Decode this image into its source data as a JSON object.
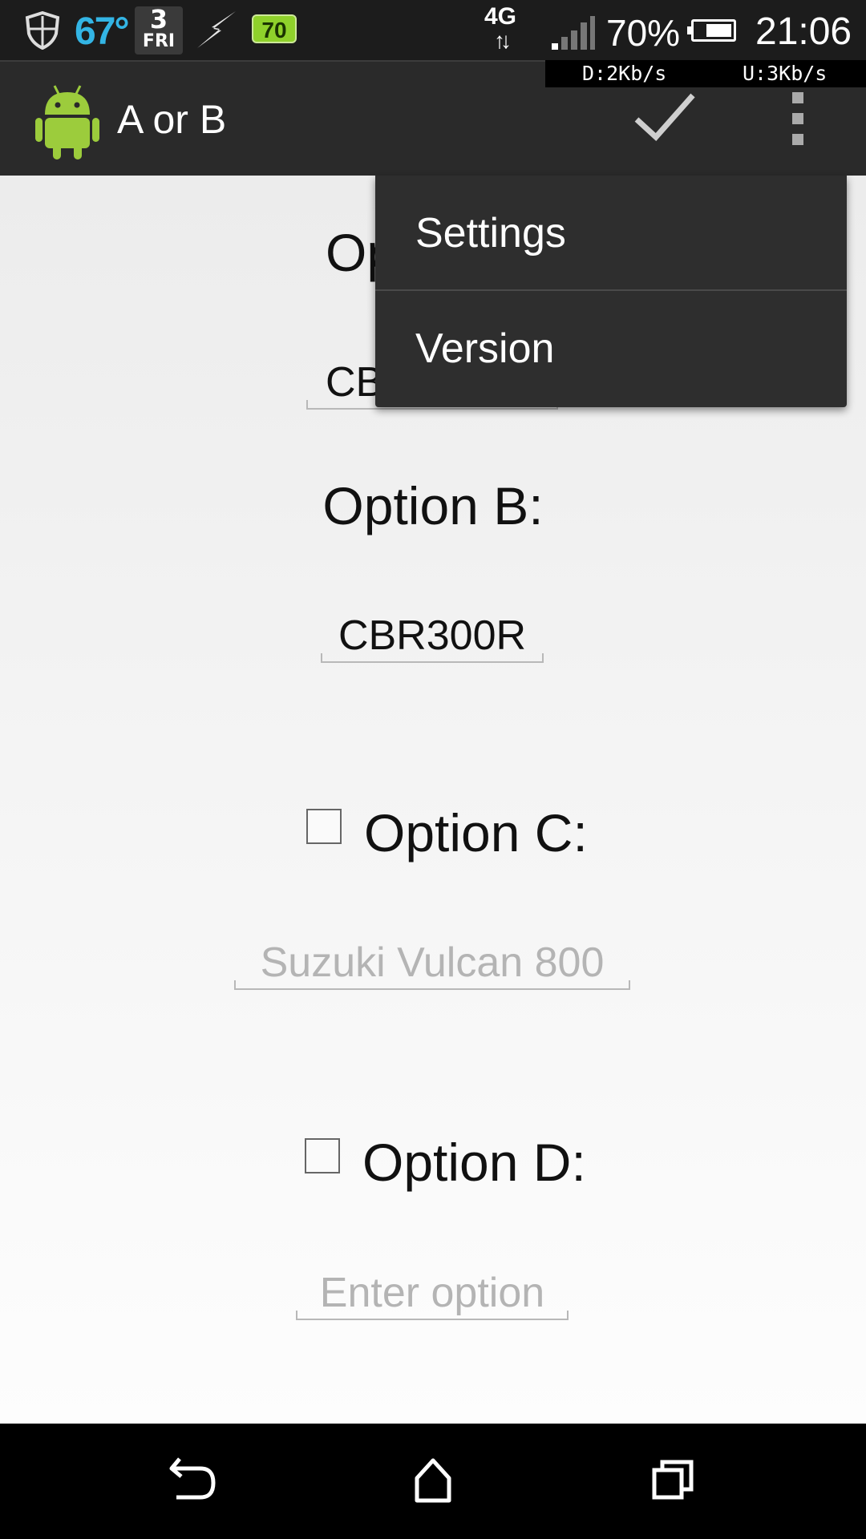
{
  "status_bar": {
    "temperature": "67°",
    "date_number": "3",
    "date_day": "FRI",
    "battery_badge": "70",
    "network": "4G",
    "battery_percent": "70%",
    "battery_level": 0.7,
    "time": "21:06",
    "download_speed": "D:2Kb/s",
    "upload_speed": "U:3Kb/s"
  },
  "action_bar": {
    "title": "A or B",
    "icons": [
      "android-icon",
      "checkmark-icon",
      "overflow-menu-icon"
    ]
  },
  "form": {
    "option_a_label": "Op",
    "option_a_value": "CB",
    "option_b_label": "Option B:",
    "option_b_value": "CBR300R",
    "option_c_label": "Option C:",
    "option_c_placeholder": "Suzuki Vulcan 800",
    "option_d_label": "Option D:",
    "option_d_placeholder": "Enter option"
  },
  "menu": {
    "items": [
      {
        "label": "Settings"
      },
      {
        "label": "Version"
      }
    ]
  },
  "nav_bar": {
    "icons": [
      "back-icon",
      "home-icon",
      "recents-icon"
    ]
  },
  "colors": {
    "status_bar": "#1c1c1c",
    "action_bar": "#2a2a2a",
    "menu_background": "#2e2e2e",
    "temperature": "#33b5e5",
    "battery_badge": "#8fd12b",
    "android_green": "#9ccc3c"
  }
}
